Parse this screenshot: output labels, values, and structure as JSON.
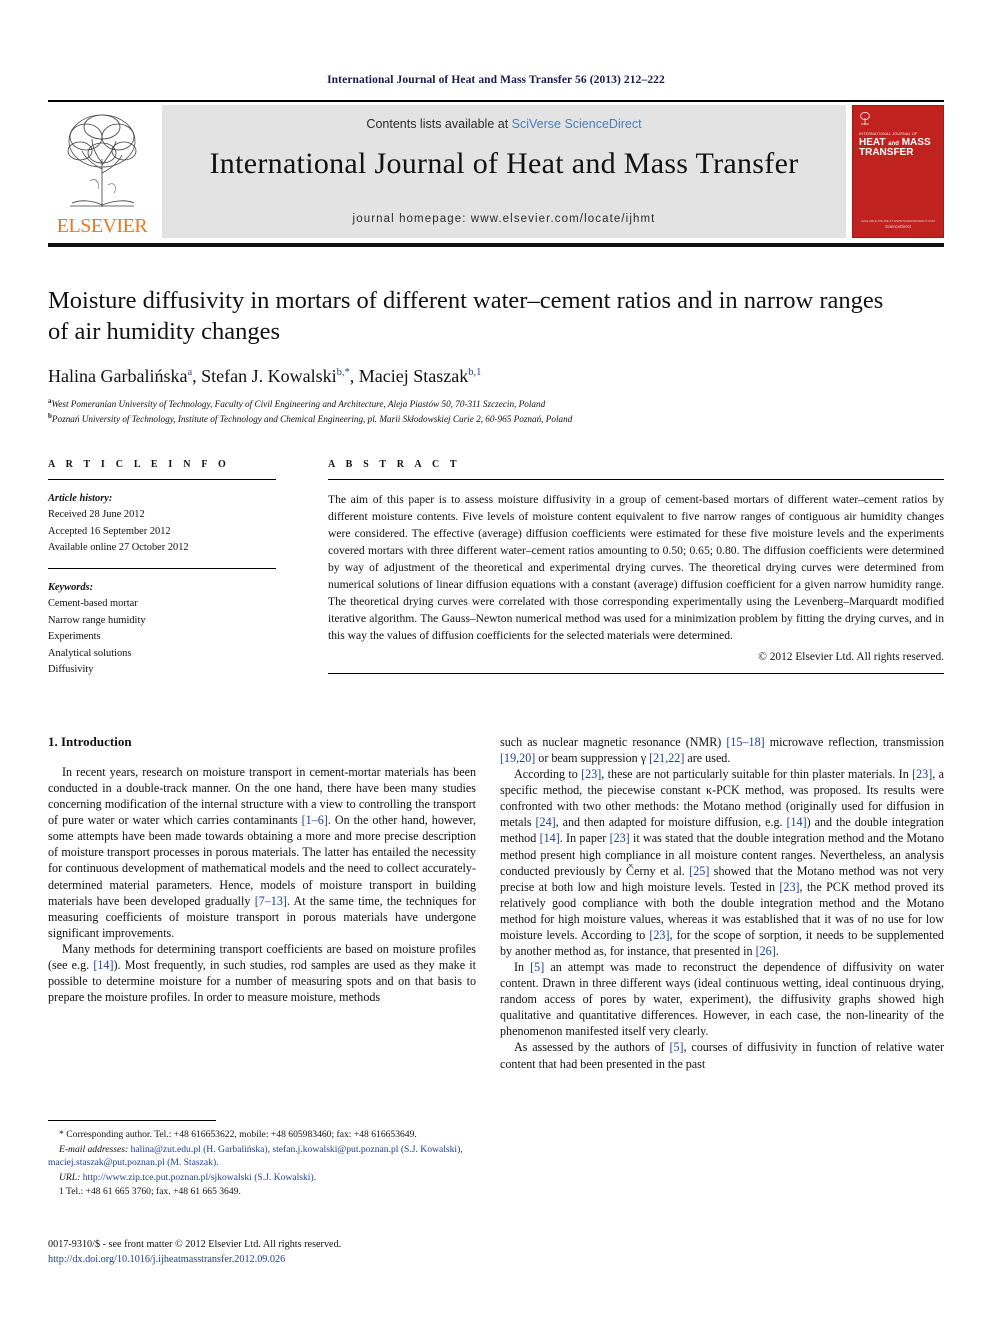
{
  "running_head": "International Journal of Heat and Mass Transfer 56 (2013) 212–222",
  "banner": {
    "publisher_name": "ELSEVIER",
    "contents_prefix": "Contents lists available at ",
    "contents_link": "SciVerse ScienceDirect",
    "journal_title": "International Journal of Heat and Mass Transfer",
    "homepage": "journal homepage: www.elsevier.com/locate/ijhmt",
    "cover": {
      "subtitle": "INTERNATIONAL JOURNAL OF",
      "title_line1": "HEAT",
      "title_and": "and",
      "title_line1b": "MASS",
      "title_line2": "TRANSFER",
      "foot_small": "AVAILABLE ONLINE AT WWW.SCIENCEDIRECT.COM",
      "foot": "ScienceDirect"
    }
  },
  "article": {
    "title": "Moisture diffusivity in mortars of different water–cement ratios and in narrow ranges of air humidity changes",
    "authors_html": "Halina Garbalińska<sup>a</sup>, Stefan J. Kowalski<sup>b,*</sup>, Maciej Staszak<sup>b,1</sup>",
    "affiliation_a": "West Pomeranian University of Technology, Faculty of Civil Engineering and Architecture, Aleja Piastów 50, 70-311 Szczecin, Poland",
    "affiliation_b": "Poznań University of Technology, Institute of Technology and Chemical Engineering, pl. Marii Skłodowskiej Curie 2, 60-965 Poznań, Poland"
  },
  "article_info": {
    "heading": "A R T I C L E  I N F O",
    "history_label": "Article history:",
    "history": [
      "Received 28 June 2012",
      "Accepted 16 September 2012",
      "Available online 27 October 2012"
    ],
    "keywords_label": "Keywords:",
    "keywords": [
      "Cement-based mortar",
      "Narrow range humidity",
      "Experiments",
      "Analytical solutions",
      "Diffusivity"
    ]
  },
  "abstract": {
    "heading": "A B S T R A C T",
    "text": "The aim of this paper is to assess moisture diffusivity in a group of cement-based mortars of different water–cement ratios by different moisture contents. Five levels of moisture content equivalent to five narrow ranges of contiguous air humidity changes were considered. The effective (average) diffusion coefficients were estimated for these five moisture levels and the experiments covered mortars with three different water–cement ratios amounting to 0.50; 0.65; 0.80. The diffusion coefficients were determined by way of adjustment of the theoretical and experimental drying curves. The theoretical drying curves were determined from numerical solutions of linear diffusion equations with a constant (average) diffusion coefficient for a given narrow humidity range. The theoretical drying curves were correlated with those corresponding experimentally using the Levenberg–Marquardt modified iterative algorithm. The Gauss–Newton numerical method was used for a minimization problem by fitting the drying curves, and in this way the values of diffusion coefficients for the selected materials were determined.",
    "copyright": "© 2012 Elsevier Ltd. All rights reserved."
  },
  "body": {
    "section_heading": "1. Introduction",
    "left_paragraphs": [
      "In recent years, research on moisture transport in cement-mortar materials has been conducted in a double-track manner. On the one hand, there have been many studies concerning modification of the internal structure with a view to controlling the transport of pure water or water which carries contaminants [1–6]. On the other hand, however, some attempts have been made towards obtaining a more and more precise description of moisture transport processes in porous materials. The latter has entailed the necessity for continuous development of mathematical models and the need to collect accurately-determined material parameters. Hence, models of moisture transport in building materials have been developed gradually [7–13]. At the same time, the techniques for measuring coefficients of moisture transport in porous materials have undergone significant improvements.",
      "Many methods for determining transport coefficients are based on moisture profiles (see e.g. [14]). Most frequently, in such studies, rod samples are used as they make it possible to determine moisture for a number of measuring spots and on that basis to prepare the moisture profiles. In order to measure moisture, methods"
    ],
    "right_paragraphs": [
      "such as nuclear magnetic resonance (NMR) [15–18] microwave reflection, transmission [19,20] or beam suppression γ [21,22] are used.",
      "According to [23], these are not particularly suitable for thin plaster materials. In [23], a specific method, the piecewise constant κ-PCK method, was proposed. Its results were confronted with two other methods: the Motano method (originally used for diffusion in metals [24], and then adapted for moisture diffusion, e.g. [14]) and the double integration method [14]. In paper [23] it was stated that the double integration method and the Motano method present high compliance in all moisture content ranges. Nevertheless, an analysis conducted previously by Černy et al. [25] showed that the Motano method was not very precise at both low and high moisture levels. Tested in [23], the PCK method proved its relatively good compliance with both the double integration method and the Motano method for high moisture values, whereas it was established that it was of no use for low moisture levels. According to [23], for the scope of sorption, it needs to be supplemented by another method as, for instance, that presented in [26].",
      "In [5] an attempt was made to reconstruct the dependence of diffusivity on water content. Drawn in three different ways (ideal continuous wetting, ideal continuous drying, random access of pores by water, experiment), the diffusivity graphs showed high qualitative and quantitative differences. However, in each case, the non-linearity of the phenomenon manifested itself very clearly.",
      "As assessed by the authors of [5], courses of diffusivity in function of relative water content that had been presented in the past"
    ]
  },
  "footnote": {
    "corresponding": "* Corresponding author. Tel.: +48 616653622, mobile: +48 605983460; fax: +48 616653649.",
    "email_label": "E-mail addresses:",
    "emails": "halina@zut.edu.pl (H. Garbalińska), stefan.j.kowalski@put.poznan.pl (S.J. Kowalski), maciej.staszak@put.poznan.pl (M. Staszak).",
    "url_label": "URL:",
    "url": "http://www.zip.tce.put.poznan.pl/sjkowalski (S.J. Kowalski).",
    "note1": "1 Tel.: +48 61 665 3760; fax. +48 61 665 3649."
  },
  "imprint": {
    "line1": "0017-9310/$ - see front matter © 2012 Elsevier Ltd. All rights reserved.",
    "doi": "http://dx.doi.org/10.1016/j.ijheatmasstransfer.2012.09.026"
  },
  "colors": {
    "link": "#1f3d99",
    "sciencedirect": "#4a7ebb",
    "elsevier_orange": "#E87722",
    "cover_red": "#c0221f",
    "banner_gray": "#e3e3e3"
  }
}
